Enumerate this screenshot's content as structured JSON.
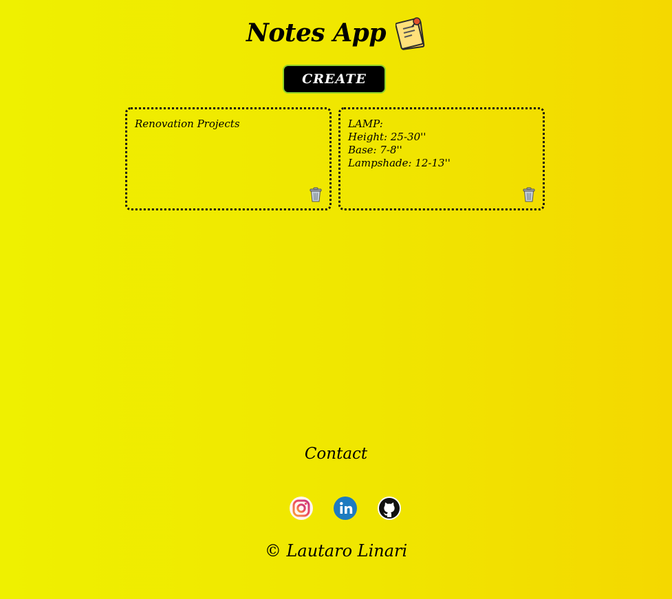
{
  "header": {
    "title": "Notes App",
    "icon": "pinned-note-icon"
  },
  "create_button": {
    "label": "CREATE"
  },
  "notes": [
    {
      "lines": [
        "Renovation Projects"
      ]
    },
    {
      "lines": [
        "LAMP:",
        "Height: 25-30''",
        "Base: 7-8''",
        "Lampshade: 12-13''"
      ]
    }
  ],
  "footer": {
    "contact_label": "Contact",
    "socials": [
      "instagram-icon",
      "linkedin-icon",
      "github-icon"
    ],
    "copyright": "© Lautaro Linari"
  },
  "colors": {
    "background": "#f0e800",
    "button": "#000000",
    "button_border": "#8fd12a"
  }
}
